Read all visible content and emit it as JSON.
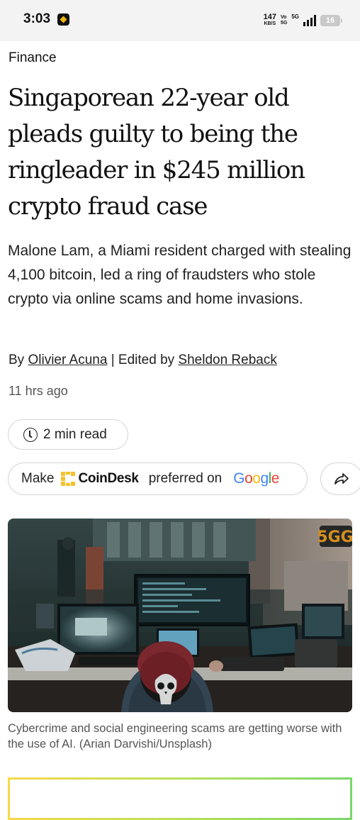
{
  "status_bar": {
    "time": "3:03",
    "speed_value": "147",
    "speed_unit": "KB/S",
    "vo_top": "Vo",
    "vo_bottom": "5G",
    "network": "5G",
    "battery": "16",
    "app_icon": "binance-icon"
  },
  "article": {
    "section": "Finance",
    "headline": "Singaporean 22-year old pleads guilty to being the ringleader in $245 million crypto fraud case",
    "dek": "Malone Lam, a Miami resident charged with stealing 4,100 bitcoin, led a ring of fraudsters who stole crypto via online scams and home invasions.",
    "by_prefix": "By",
    "author": "Olivier Acuna",
    "edited_prefix": "| Edited by",
    "editor": "Sheldon Reback",
    "time_ago": "11 hrs ago",
    "read_time": "2 min read"
  },
  "preferred": {
    "make": "Make",
    "brand": "CoinDesk",
    "middle": "preferred on",
    "google": "Google"
  },
  "hero": {
    "sign_text": "5GG",
    "caption": "Cybercrime and social engineering scams are getting worse with the use of AI. (Arian Darvishi/Unsplash)"
  },
  "icons": {
    "clock": "clock-icon",
    "share": "share-icon",
    "coindesk": "coindesk-logo-icon"
  },
  "colors": {
    "coindesk_yellow": "#f7c12b",
    "google_blue": "#4285f4",
    "google_red": "#ea4335",
    "google_yellow": "#fbbc05",
    "google_green": "#34a853"
  }
}
